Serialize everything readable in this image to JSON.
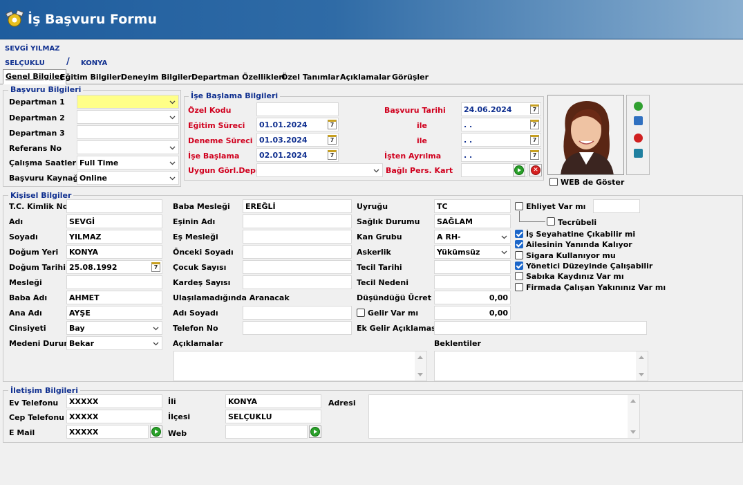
{
  "header": {
    "title": "İş Başvuru Formu"
  },
  "applicant": {
    "name": "SEVGİ YILMAZ",
    "district": "SELÇUKLU",
    "separator": "/",
    "city": "KONYA"
  },
  "tabs": [
    "Genel Bilgiler",
    "Eğitim Bilgileri",
    "Deneyim Bilgileri",
    "Departman Özellikleri",
    "Özel Tanımlar",
    "Açıklamalar",
    "Görüşler"
  ],
  "basvuru": {
    "title": "Başvuru Bilgileri",
    "departman1_label": "Departman 1",
    "departman1": "",
    "departman2_label": "Departman 2",
    "departman2": "",
    "departman3_label": "Departman 3",
    "departman3": "",
    "referans_label": "Referans No",
    "referans": "",
    "calisma_label": "Çalışma Saatleri",
    "calisma": "Full Time",
    "kaynak_label": "Başvuru Kaynağı",
    "kaynak": "Online"
  },
  "ise_baslama": {
    "title": "İşe Başlama Bilgileri",
    "ozel_kodu_label": "Özel Kodu",
    "ozel_kodu": "",
    "egitim_label": "Eğitim Süreci",
    "egitim": "01.01.2024",
    "deneme_label": "Deneme Süreci",
    "deneme": "01.03.2024",
    "baslama_label": "İşe Başlama",
    "baslama": "02.01.2024",
    "uygun_label": "Uygun Görl.Depr.",
    "uygun": "",
    "basvuru_tarihi_label": "Başvuru Tarihi",
    "basvuru_tarihi": "24.06.2024",
    "ile_label": "ile",
    "ile1": ". .",
    "ile2": ". .",
    "ayrilma_label": "İşten Ayrılma",
    "ayrilma": ". .",
    "bagli_label": "Bağlı Pers. Kart",
    "bagli": ""
  },
  "photo": {
    "web_label": "WEB de Göster",
    "web_checked": false
  },
  "kisisel": {
    "title": "Kişisel Bilgiler",
    "col1": [
      {
        "label": "T.C. Kimlik No",
        "value": ""
      },
      {
        "label": "Adı",
        "value": "SEVGİ"
      },
      {
        "label": "Soyadı",
        "value": "YILMAZ"
      },
      {
        "label": "Doğum Yeri",
        "value": "KONYA"
      },
      {
        "label": "Doğum Tarihi",
        "value": "25.08.1992"
      },
      {
        "label": "Mesleği",
        "value": ""
      },
      {
        "label": "Baba Adı",
        "value": "AHMET"
      },
      {
        "label": "Ana Adı",
        "value": "AYŞE"
      },
      {
        "label": "Cinsiyeti",
        "value": "Bay"
      },
      {
        "label": "Medeni Durum",
        "value": "Bekar"
      }
    ],
    "col2": [
      {
        "label": "Baba Mesleği",
        "value": "EREĞLİ"
      },
      {
        "label": "Eşinin Adı",
        "value": ""
      },
      {
        "label": "Eş Mesleği",
        "value": ""
      },
      {
        "label": "Önceki Soyadı",
        "value": ""
      },
      {
        "label": "Çocuk Sayısı",
        "value": ""
      },
      {
        "label": "Kardeş Sayısı",
        "value": ""
      },
      {
        "label": "Ulaşılamadığında Aranacak",
        "value": ""
      },
      {
        "label": "Adı Soyadı",
        "value": ""
      },
      {
        "label": "Telefon No",
        "value": ""
      },
      {
        "label": "Açıklamalar",
        "value": ""
      }
    ],
    "col3": [
      {
        "label": "Uyruğu",
        "value": "TC"
      },
      {
        "label": "Sağlık Durumu",
        "value": "SAĞLAM"
      },
      {
        "label": "Kan Grubu",
        "value": "A RH-"
      },
      {
        "label": "Askerlik",
        "value": "Yükümsüz"
      },
      {
        "label": "Tecil Tarihi",
        "value": ""
      },
      {
        "label": "Tecil Nedeni",
        "value": ""
      },
      {
        "label": "Düşündüğü Ücret",
        "value": "0,00"
      },
      {
        "label": "Gelir Var mı",
        "value": "0,00"
      },
      {
        "label": "Ek Gelir Açıklaması",
        "value": ""
      },
      {
        "label": "Beklentiler",
        "value": ""
      }
    ],
    "checks": [
      {
        "label": "Ehliyet Var mı",
        "checked": false
      },
      {
        "label": "Tecrübeli",
        "checked": false
      },
      {
        "label": "İş Seyahatine Çıkabilir mi",
        "checked": true
      },
      {
        "label": "Ailesinin Yanında Kalıyor",
        "checked": true
      },
      {
        "label": "Sigara Kullanıyor mu",
        "checked": false
      },
      {
        "label": "Yönetici Düzeyinde Çalışabilir",
        "checked": true
      },
      {
        "label": "Sabıka Kaydınız Var mı",
        "checked": false
      },
      {
        "label": "Firmada Çalışan Yakınınız Var mı",
        "checked": false
      }
    ]
  },
  "iletisim": {
    "title": "İletişim Bilgileri",
    "ev_label": "Ev Telefonu",
    "ev": "XXXXX",
    "cep_label": "Cep Telefonu",
    "cep": "XXXXX",
    "mail_label": "E Mail",
    "mail": "XXXXX",
    "il_label": "İli",
    "il": "KONYA",
    "ilce_label": "İlçesi",
    "ilce": "SELÇUKLU",
    "web_label": "Web",
    "web": "",
    "adres_label": "Adresi",
    "adres": ""
  }
}
